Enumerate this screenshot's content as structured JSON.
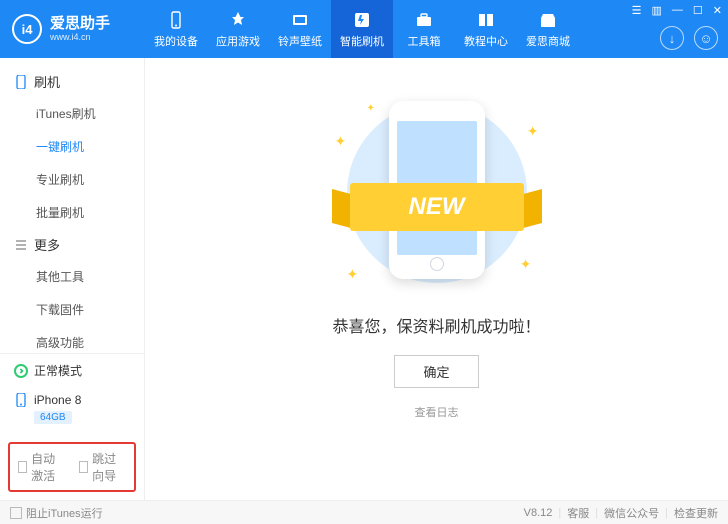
{
  "logo": {
    "badge": "i4",
    "cn": "爱思助手",
    "url": "www.i4.cn"
  },
  "tabs": [
    {
      "label": "我的设备",
      "icon": "device"
    },
    {
      "label": "应用游戏",
      "icon": "apps"
    },
    {
      "label": "铃声壁纸",
      "icon": "ringtone"
    },
    {
      "label": "智能刷机",
      "icon": "flash",
      "active": true
    },
    {
      "label": "工具箱",
      "icon": "toolbox"
    },
    {
      "label": "教程中心",
      "icon": "tutorial"
    },
    {
      "label": "爱思商城",
      "icon": "store"
    }
  ],
  "sidebar": {
    "groups": [
      {
        "title": "刷机",
        "icon": "phone",
        "items": [
          {
            "label": "iTunes刷机"
          },
          {
            "label": "一键刷机",
            "active": true
          },
          {
            "label": "专业刷机"
          },
          {
            "label": "批量刷机"
          }
        ]
      },
      {
        "title": "更多",
        "icon": "menu",
        "items": [
          {
            "label": "其他工具"
          },
          {
            "label": "下载固件"
          },
          {
            "label": "高级功能"
          }
        ]
      }
    ],
    "mode": "正常模式",
    "device": {
      "name": "iPhone 8",
      "storage": "64GB"
    },
    "opts": {
      "auto_activate": "自动激活",
      "skip_guide": "跳过向导"
    }
  },
  "main": {
    "ribbon": "NEW",
    "message": "恭喜您，保资料刷机成功啦！",
    "ok": "确定",
    "log": "查看日志"
  },
  "footer": {
    "block_itunes": "阻止iTunes运行",
    "version": "V8.12",
    "support": "客服",
    "wechat": "微信公众号",
    "update": "检查更新"
  }
}
